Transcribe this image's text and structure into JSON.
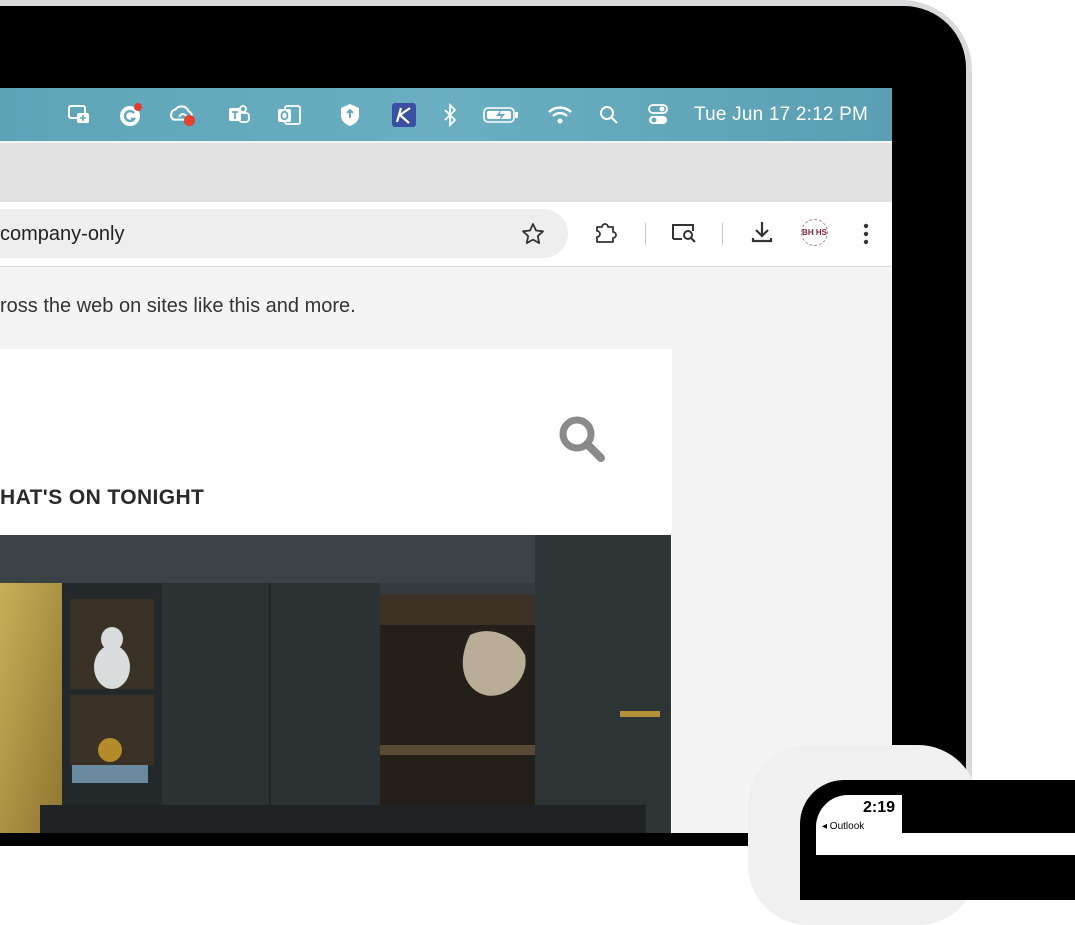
{
  "menubar": {
    "clock": "Tue Jun 17  2:12 PM",
    "icons": [
      "screen-share-icon",
      "grammarly-icon",
      "creative-cloud-icon",
      "teams-icon",
      "outlook-icon",
      "vpn-shield-icon",
      "klack-icon",
      "bluetooth-icon",
      "battery-icon",
      "wifi-icon",
      "spotlight-search-icon",
      "control-center-icon"
    ]
  },
  "browser": {
    "url": "company-only",
    "bookmark_icon": "star-icon",
    "extensions_icon": "puzzle-icon",
    "avatar_text": "BH HS"
  },
  "page": {
    "promo": "ross the web on sites like this and more.",
    "ad_heading": "HAT'S ON TONIGHT"
  },
  "phone": {
    "time": "2:19",
    "back_label": "◂ Outlook"
  },
  "colors": {
    "menubar": "#64a9bc",
    "bezel": "#000000",
    "page_bg": "#f4f4f4"
  }
}
